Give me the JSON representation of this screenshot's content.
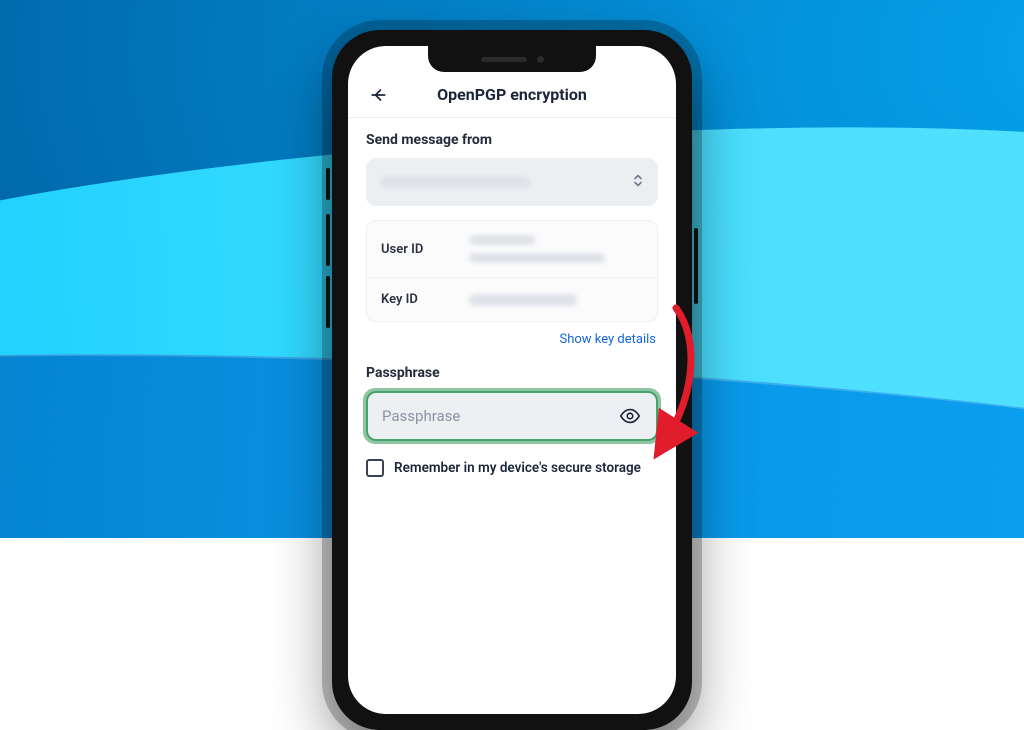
{
  "topbar": {
    "title": "OpenPGP encryption"
  },
  "from": {
    "label": "Send message from"
  },
  "keyinfo": {
    "user_id_label": "User ID",
    "key_id_label": "Key ID",
    "show_details": "Show key details"
  },
  "passphrase": {
    "label": "Passphrase",
    "placeholder": "Passphrase",
    "value": ""
  },
  "remember": {
    "label": "Remember in my device's secure storage"
  },
  "annotation": {
    "arrow_color": "#e11d2c"
  }
}
